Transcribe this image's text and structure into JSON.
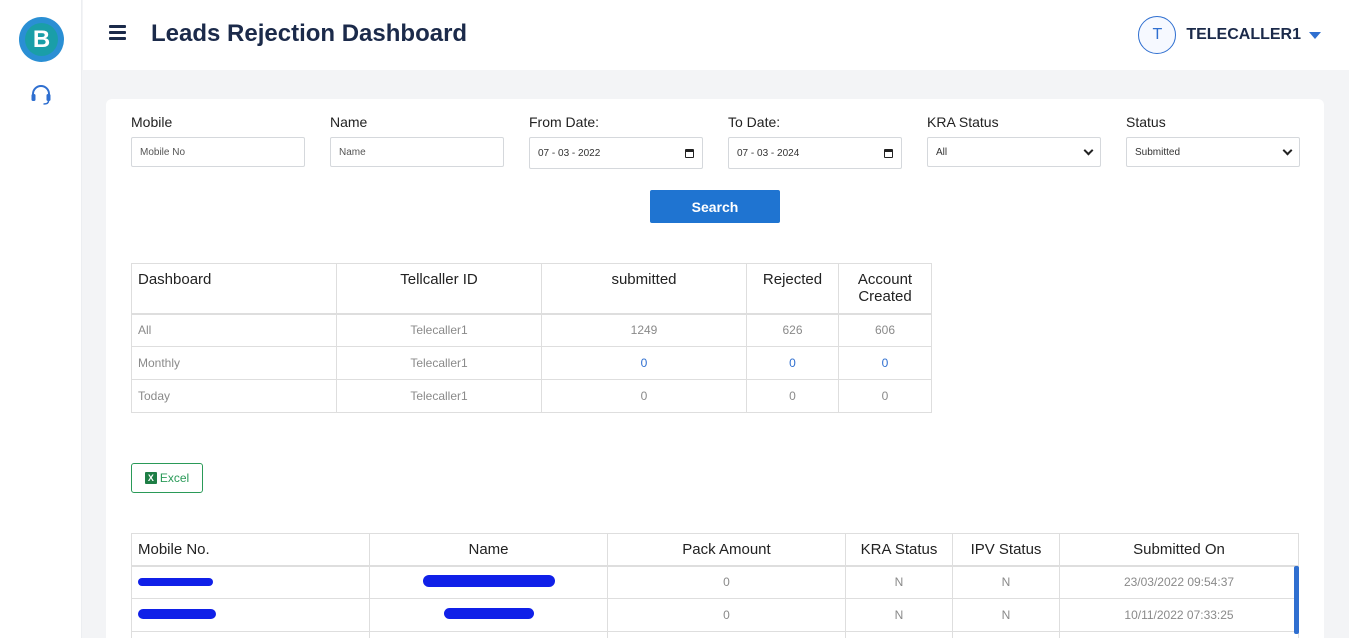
{
  "header": {
    "title": "Leads Rejection Dashboard",
    "user_initial": "T",
    "username": "TELECALLER1"
  },
  "sidebar": {
    "logo_letter": "B",
    "icons": [
      "headset-icon"
    ]
  },
  "filters": {
    "mobile": {
      "label": "Mobile",
      "placeholder": "Mobile No"
    },
    "name": {
      "label": "Name",
      "placeholder": "Name"
    },
    "from_date": {
      "label": "From Date:",
      "value": "07 - 03 - 2022"
    },
    "to_date": {
      "label": "To Date:",
      "value": "07 - 03 - 2024"
    },
    "kra_status": {
      "label": "KRA Status",
      "value": "All"
    },
    "status": {
      "label": "Status",
      "value": "Submitted"
    },
    "search_label": "Search"
  },
  "summary": {
    "headers": [
      "Dashboard",
      "Tellcaller ID",
      "submitted",
      "Rejected",
      "Account Created"
    ],
    "rows": [
      [
        "All",
        "Telecaller1",
        "1249",
        "626",
        "606"
      ],
      [
        "Monthly",
        "Telecaller1",
        "0",
        "0",
        "0"
      ],
      [
        "Today",
        "Telecaller1",
        "0",
        "0",
        "0"
      ]
    ]
  },
  "excel_label": "Excel",
  "leads": {
    "headers": [
      "Mobile No.",
      "Name",
      "Pack Amount",
      "KRA Status",
      "IPV Status",
      "Submitted On"
    ],
    "rows": [
      [
        "",
        "",
        "0",
        "N",
        "N",
        "23/03/2022 09:54:37"
      ],
      [
        "",
        "",
        "0",
        "N",
        "N",
        "10/11/2022 07:33:25"
      ]
    ]
  },
  "colors": {
    "primary": "#1f74d1",
    "title": "#1b2a4a",
    "excel": "#2a9a58",
    "redaction": "#1020e8"
  }
}
